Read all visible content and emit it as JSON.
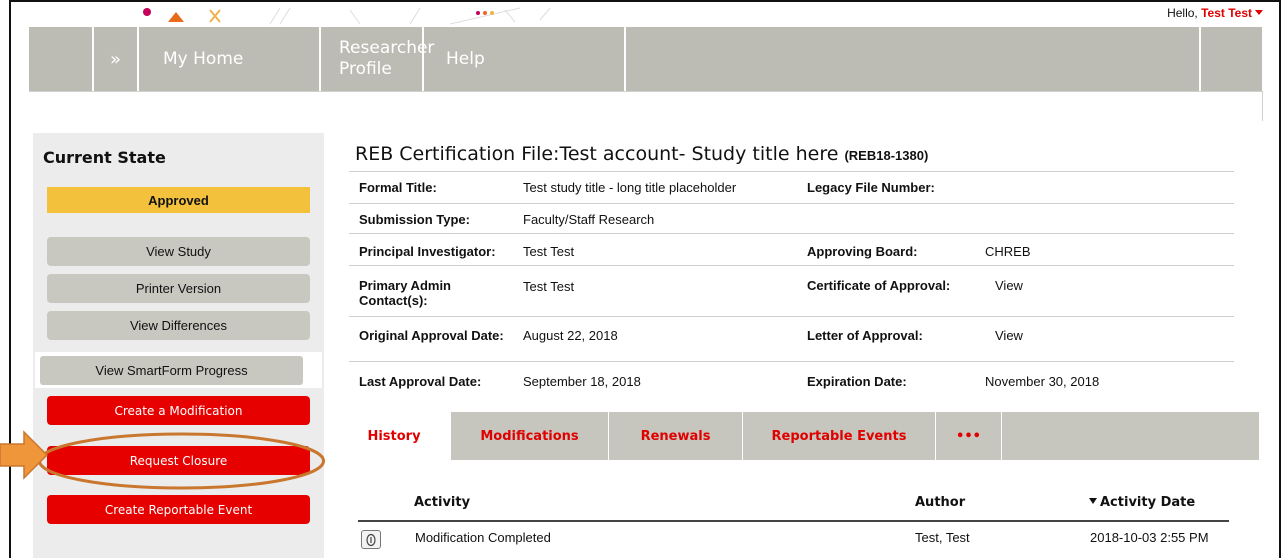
{
  "header": {
    "greeting": "Hello,",
    "user_name": "Test Test"
  },
  "nav": {
    "expand_label": "»",
    "items": [
      {
        "label": "My Home"
      },
      {
        "label": "Researcher",
        "label2": "Profile"
      },
      {
        "label": "Help"
      }
    ]
  },
  "sidebar": {
    "title": "Current State",
    "state": "Approved",
    "buttons": {
      "view_study": "View Study",
      "printer_version": "Printer Version",
      "view_differences": "View Differences",
      "smartform_progress": "View SmartForm Progress",
      "create_modification": "Create a Modification",
      "request_closure": "Request Closure",
      "create_reportable_event": "Create Reportable Event"
    }
  },
  "main": {
    "title": "REB Certification File:Test account- Study title here",
    "file_code": "(REB18-1380)",
    "fields": {
      "formal_title_label": "Formal Title:",
      "formal_title_value": "Test study title - long title placeholder",
      "legacy_label": "Legacy File Number:",
      "legacy_value": "",
      "submission_type_label": "Submission Type:",
      "submission_type_value": "Faculty/Staff Research",
      "pi_label": "Principal Investigator:",
      "pi_value": "Test Test",
      "board_label": "Approving Board:",
      "board_value": "CHREB",
      "admin_label": "Primary Admin Contact(s):",
      "admin_value": "Test Test",
      "certificate_label": "Certificate of Approval:",
      "certificate_value": "View",
      "orig_approval_label": "Original Approval Date:",
      "orig_approval_value": "August 22, 2018",
      "letter_label": "Letter of Approval:",
      "letter_value": "View",
      "last_approval_label": "Last Approval Date:",
      "last_approval_value": "September 18, 2018",
      "expiration_label": "Expiration Date:",
      "expiration_value": "November 30, 2018"
    }
  },
  "tabs": {
    "history": "History",
    "modifications": "Modifications",
    "renewals": "Renewals",
    "reportable_events": "Reportable Events",
    "more": "•••"
  },
  "history_table": {
    "columns": {
      "activity": "Activity",
      "author": "Author",
      "activity_date": "Activity Date"
    },
    "rows": [
      {
        "activity": "Modification Completed",
        "author": "Test, Test",
        "date": "2018-10-03 2:55 PM"
      }
    ]
  },
  "colors": {
    "brand_red": "#e60000",
    "approved_yellow": "#f3c13b",
    "nav_gray": "#bdbcb4",
    "highlight_orange": "#c9772e"
  }
}
